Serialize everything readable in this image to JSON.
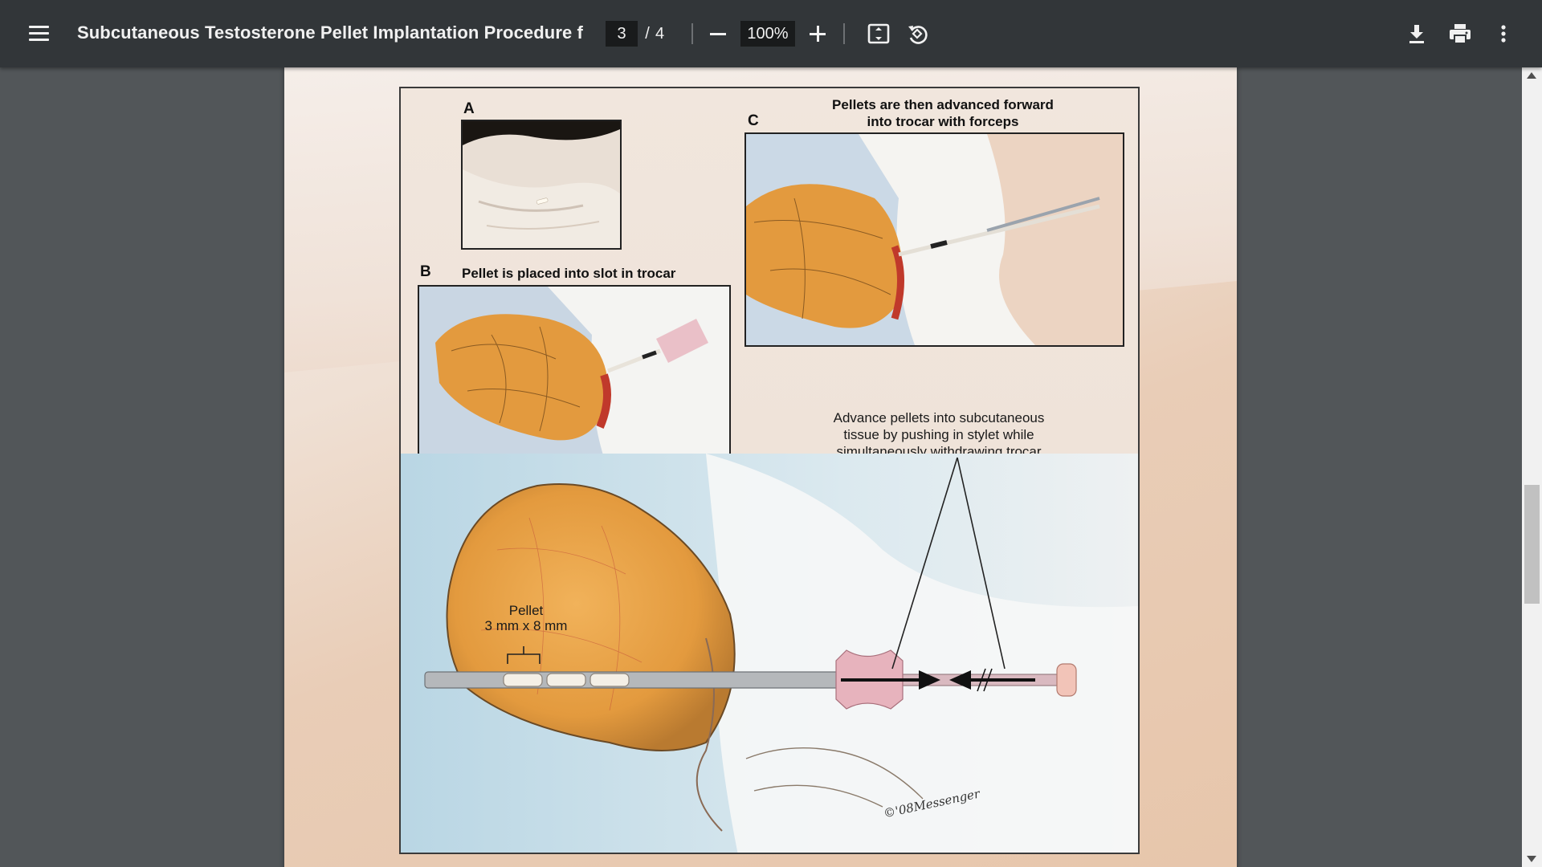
{
  "toolbar": {
    "title": "Subcutaneous Testosterone Pellet Implantation Procedure for Tr...",
    "current_page": "3",
    "page_separator": "/",
    "total_pages": "4",
    "zoom": "100%",
    "icons": {
      "menu": "menu-icon",
      "zoom_out": "minus-icon",
      "zoom_in": "plus-icon",
      "fit": "fit-page-icon",
      "rotate": "rotate-icon",
      "download": "download-icon",
      "print": "print-icon",
      "more": "more-vertical-icon"
    }
  },
  "figure": {
    "label_a": "A",
    "label_b": "B",
    "label_c": "C",
    "caption_b": "Pellet is placed into slot in trocar",
    "caption_c_line1": "Pellets are then advanced forward",
    "caption_c_line2": "into trocar with forceps",
    "note_line1": "Advance pellets into subcutaneous",
    "note_line2": "tissue by pushing in stylet while",
    "note_line3": "simultaneously withdrawing trocar",
    "pellet_line1": "Pellet",
    "pellet_line2": "3 mm x 8 mm",
    "signature": "©'08Messenger"
  },
  "colors": {
    "toolbar_bg": "#323639",
    "viewer_bg": "#525659",
    "input_bg": "#191b1c",
    "tissue_orange": "#e39a3e",
    "incision_red": "#c0392b"
  }
}
